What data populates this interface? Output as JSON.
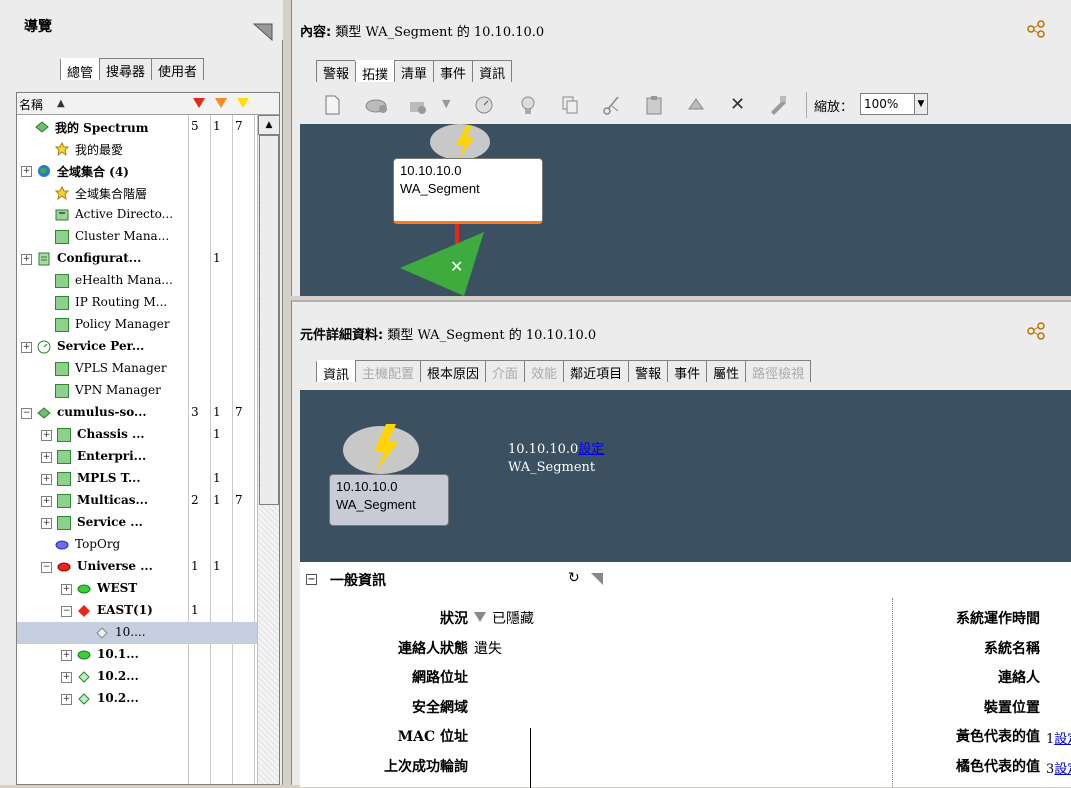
{
  "nav": {
    "title": "導覽",
    "tabs": [
      "總管",
      "搜尋器",
      "使用者"
    ],
    "column_name": "名稱",
    "rows": [
      {
        "label": "我的 Spectrum",
        "bold": true,
        "c1": "5",
        "c2": "1",
        "c3": "7",
        "icon": "spectrum-icon"
      },
      {
        "label": "我的最愛",
        "icon": "star-icon"
      },
      {
        "label": "全域集合 (4)",
        "bold": true,
        "icon": "globe-icon",
        "exp": "+"
      },
      {
        "label": "全域集合階層",
        "icon": "star-icon"
      },
      {
        "label": "Active Directo...",
        "icon": "server-icon"
      },
      {
        "label": "Cluster Mana...",
        "icon": "square-icon"
      },
      {
        "label": "Configurat...",
        "bold": true,
        "c2": "1",
        "icon": "doc-icon",
        "exp": "+"
      },
      {
        "label": "eHealth Mana...",
        "icon": "square-icon"
      },
      {
        "label": "IP Routing M...",
        "icon": "square-icon"
      },
      {
        "label": "Policy Manager",
        "icon": "square-icon"
      },
      {
        "label": "Service Per...",
        "bold": true,
        "icon": "clock-icon",
        "exp": "+"
      },
      {
        "label": "VPLS Manager",
        "icon": "square-icon"
      },
      {
        "label": "VPN Manager",
        "icon": "square-icon"
      },
      {
        "label": "cumulus-so...",
        "bold": true,
        "c1": "3",
        "c2": "1",
        "c3": "7",
        "icon": "spectrum-icon",
        "exp": "−"
      },
      {
        "label": "Chassis ...",
        "bold": true,
        "c2": "1",
        "icon": "square-icon",
        "exp": "+"
      },
      {
        "label": "Enterpri...",
        "bold": true,
        "icon": "square-icon",
        "exp": "+"
      },
      {
        "label": "MPLS T...",
        "bold": true,
        "c2": "1",
        "icon": "square-icon",
        "exp": "+"
      },
      {
        "label": "Multicas...",
        "bold": true,
        "c1": "2",
        "c2": "1",
        "c3": "7",
        "icon": "square-icon",
        "exp": "+"
      },
      {
        "label": "Service ...",
        "bold": true,
        "icon": "square-icon",
        "exp": "+"
      },
      {
        "label": "TopOrg",
        "icon": "blue-oval-icon"
      },
      {
        "label": "Universe ...",
        "bold": true,
        "c1": "1",
        "c2": "1",
        "icon": "red-oval-icon",
        "exp": "−"
      },
      {
        "label": "WEST",
        "bold": true,
        "icon": "green-oval-icon",
        "exp": "+"
      },
      {
        "label": "EAST(1)",
        "bold": true,
        "c1": "1",
        "icon": "red-diamond-icon",
        "exp": "−"
      },
      {
        "label": "10....",
        "icon": "gray-diamond-icon"
      },
      {
        "label": "10.1...",
        "bold": true,
        "icon": "green-oval-icon",
        "exp": "+"
      },
      {
        "label": "10.2...",
        "bold": true,
        "icon": "green-diamond-icon",
        "exp": "+"
      },
      {
        "label": "10.2...",
        "bold": true,
        "icon": "green-diamond-icon",
        "exp": "+"
      }
    ]
  },
  "content": {
    "title_bold": "內容:",
    "title_rest": " 類型 WA_Segment 的 10.10.10.0",
    "tabs": [
      "警報",
      "拓撲",
      "清單",
      "事件",
      "資訊"
    ],
    "zoom_label": "縮放：",
    "zoom_value": "100%",
    "node_ip": "10.10.10.0",
    "node_type": "WA_Segment"
  },
  "details": {
    "title_bold": "元件詳細資料:",
    "title_rest": " 類型 WA_Segment 的 10.10.10.0",
    "tabs": [
      "資訊",
      "主機配置",
      "根本原因",
      "介面",
      "效能",
      "鄰近項目",
      "警報",
      "事件",
      "屬性",
      "路徑檢視"
    ],
    "node_ip": "10.10.10.0",
    "node_type": "WA_Segment",
    "header_ip": "10.10.10.0",
    "header_link": "設定",
    "header_type": "WA_Segment",
    "section": "一般資訊",
    "fields_left": [
      {
        "label": "狀況",
        "value": "已隱藏"
      },
      {
        "label": "連絡人狀態",
        "value": "遺失"
      },
      {
        "label": "網路位址",
        "value": ""
      },
      {
        "label": "安全網域",
        "value": ""
      },
      {
        "label": "MAC 位址",
        "value": ""
      },
      {
        "label": "上次成功輪詢",
        "value": ""
      }
    ],
    "fields_right": [
      {
        "label": "系統運作時間",
        "value": ""
      },
      {
        "label": "系統名稱",
        "value": ""
      },
      {
        "label": "連絡人",
        "value": ""
      },
      {
        "label": "裝置位置",
        "value": ""
      },
      {
        "label": "黃色代表的值",
        "value": "1",
        "link": "設定"
      },
      {
        "label": "橘色代表的值",
        "value": "3",
        "link": "設定"
      }
    ]
  },
  "colors": {
    "canvas": "#3b5060",
    "red": "#e8261b",
    "orange": "#ff8a1c",
    "yellow": "#ffe000"
  }
}
